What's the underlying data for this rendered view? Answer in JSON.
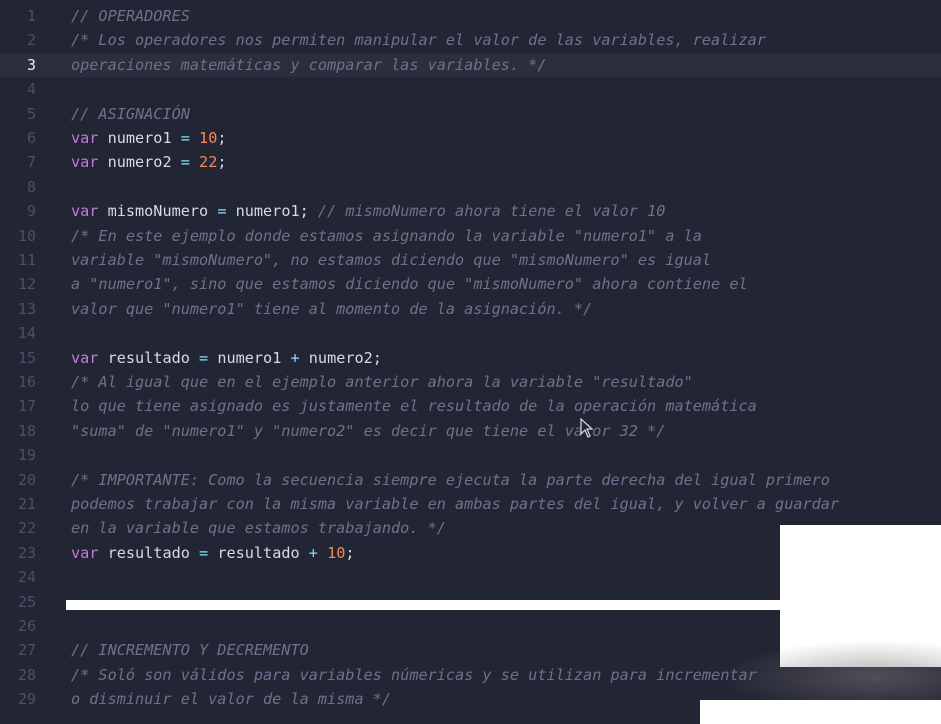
{
  "editor": {
    "active_line": 3,
    "lines": [
      {
        "n": "1",
        "tokens": [
          {
            "t": "// OPERADORES",
            "c": "comment"
          }
        ]
      },
      {
        "n": "2",
        "tokens": [
          {
            "t": "/* Los operadores nos permiten manipular el valor de las variables, realizar",
            "c": "comment"
          }
        ]
      },
      {
        "n": "3",
        "tokens": [
          {
            "t": "operaciones matemáticas y comparar las variables. */",
            "c": "comment"
          }
        ]
      },
      {
        "n": "4",
        "tokens": []
      },
      {
        "n": "5",
        "tokens": [
          {
            "t": "// ASIGNACIÓN",
            "c": "comment"
          }
        ]
      },
      {
        "n": "6",
        "tokens": [
          {
            "t": "var",
            "c": "kw"
          },
          {
            "t": " numero1 ",
            "c": "id"
          },
          {
            "t": "=",
            "c": "op"
          },
          {
            "t": " ",
            "c": "id"
          },
          {
            "t": "10",
            "c": "num"
          },
          {
            "t": ";",
            "c": "punct"
          }
        ]
      },
      {
        "n": "7",
        "tokens": [
          {
            "t": "var",
            "c": "kw"
          },
          {
            "t": " numero2 ",
            "c": "id"
          },
          {
            "t": "=",
            "c": "op"
          },
          {
            "t": " ",
            "c": "id"
          },
          {
            "t": "22",
            "c": "num"
          },
          {
            "t": ";",
            "c": "punct"
          }
        ]
      },
      {
        "n": "8",
        "tokens": []
      },
      {
        "n": "9",
        "tokens": [
          {
            "t": "var",
            "c": "kw"
          },
          {
            "t": " mismoNumero ",
            "c": "id"
          },
          {
            "t": "=",
            "c": "op"
          },
          {
            "t": " numero1; ",
            "c": "id"
          },
          {
            "t": "// mismoNumero ahora tiene el valor 10",
            "c": "comment"
          }
        ]
      },
      {
        "n": "10",
        "tokens": [
          {
            "t": "/* En este ejemplo donde estamos asignando la variable \"numero1\" a la",
            "c": "comment"
          }
        ]
      },
      {
        "n": "11",
        "tokens": [
          {
            "t": "variable \"mismoNumero\", no estamos diciendo que \"mismoNumero\" es igual",
            "c": "comment"
          }
        ]
      },
      {
        "n": "12",
        "tokens": [
          {
            "t": "a \"numero1\", sino que estamos diciendo que \"mismoNumero\" ahora contiene el",
            "c": "comment"
          }
        ]
      },
      {
        "n": "13",
        "tokens": [
          {
            "t": "valor que \"numero1\" tiene al momento de la asignación. */",
            "c": "comment"
          }
        ]
      },
      {
        "n": "14",
        "tokens": []
      },
      {
        "n": "15",
        "tokens": [
          {
            "t": "var",
            "c": "kw"
          },
          {
            "t": " resultado ",
            "c": "id"
          },
          {
            "t": "=",
            "c": "op"
          },
          {
            "t": " numero1 ",
            "c": "id"
          },
          {
            "t": "+",
            "c": "op"
          },
          {
            "t": " numero2;",
            "c": "id"
          }
        ]
      },
      {
        "n": "16",
        "tokens": [
          {
            "t": "/* Al igual que en el ejemplo anterior ahora la variable \"resultado\"",
            "c": "comment"
          }
        ]
      },
      {
        "n": "17",
        "tokens": [
          {
            "t": "lo que tiene asignado es justamente el resultado de la operación matemática",
            "c": "comment"
          }
        ]
      },
      {
        "n": "18",
        "tokens": [
          {
            "t": "\"suma\" de \"numero1\" y \"numero2\" es decir que tiene el valor 32 */",
            "c": "comment"
          }
        ]
      },
      {
        "n": "19",
        "tokens": []
      },
      {
        "n": "20",
        "tokens": [
          {
            "t": "/* IMPORTANTE: Como la secuencia siempre ejecuta la parte derecha del igual primero",
            "c": "comment"
          }
        ]
      },
      {
        "n": "21",
        "tokens": [
          {
            "t": "podemos trabajar con la misma variable en ambas partes del igual, y volver a guardar",
            "c": "comment"
          }
        ]
      },
      {
        "n": "22",
        "tokens": [
          {
            "t": "en la variable que estamos trabajando. */",
            "c": "comment"
          }
        ]
      },
      {
        "n": "23",
        "tokens": [
          {
            "t": "var",
            "c": "kw"
          },
          {
            "t": " resultado ",
            "c": "id"
          },
          {
            "t": "=",
            "c": "op"
          },
          {
            "t": " resultado ",
            "c": "id"
          },
          {
            "t": "+",
            "c": "op"
          },
          {
            "t": " ",
            "c": "id"
          },
          {
            "t": "10",
            "c": "num"
          },
          {
            "t": ";",
            "c": "punct"
          }
        ]
      },
      {
        "n": "24",
        "tokens": []
      },
      {
        "n": "25",
        "tokens": []
      },
      {
        "n": "26",
        "tokens": []
      },
      {
        "n": "27",
        "tokens": [
          {
            "t": "// INCREMENTO Y DECREMENTO",
            "c": "comment"
          }
        ]
      },
      {
        "n": "28",
        "tokens": [
          {
            "t": "/* Soló son válidos para variables númericas y se utilizan para incrementar",
            "c": "comment"
          }
        ]
      },
      {
        "n": "29",
        "tokens": [
          {
            "t": "o disminuir el valor de la misma */",
            "c": "comment"
          }
        ]
      }
    ]
  },
  "colors": {
    "background": "#222634",
    "comment": "#6c728c",
    "keyword": "#c678dd",
    "identifier": "#d7dae3",
    "operator": "#89ddff",
    "number": "#f7875a"
  },
  "icons": {
    "cursor": "mouse-pointer-icon"
  }
}
